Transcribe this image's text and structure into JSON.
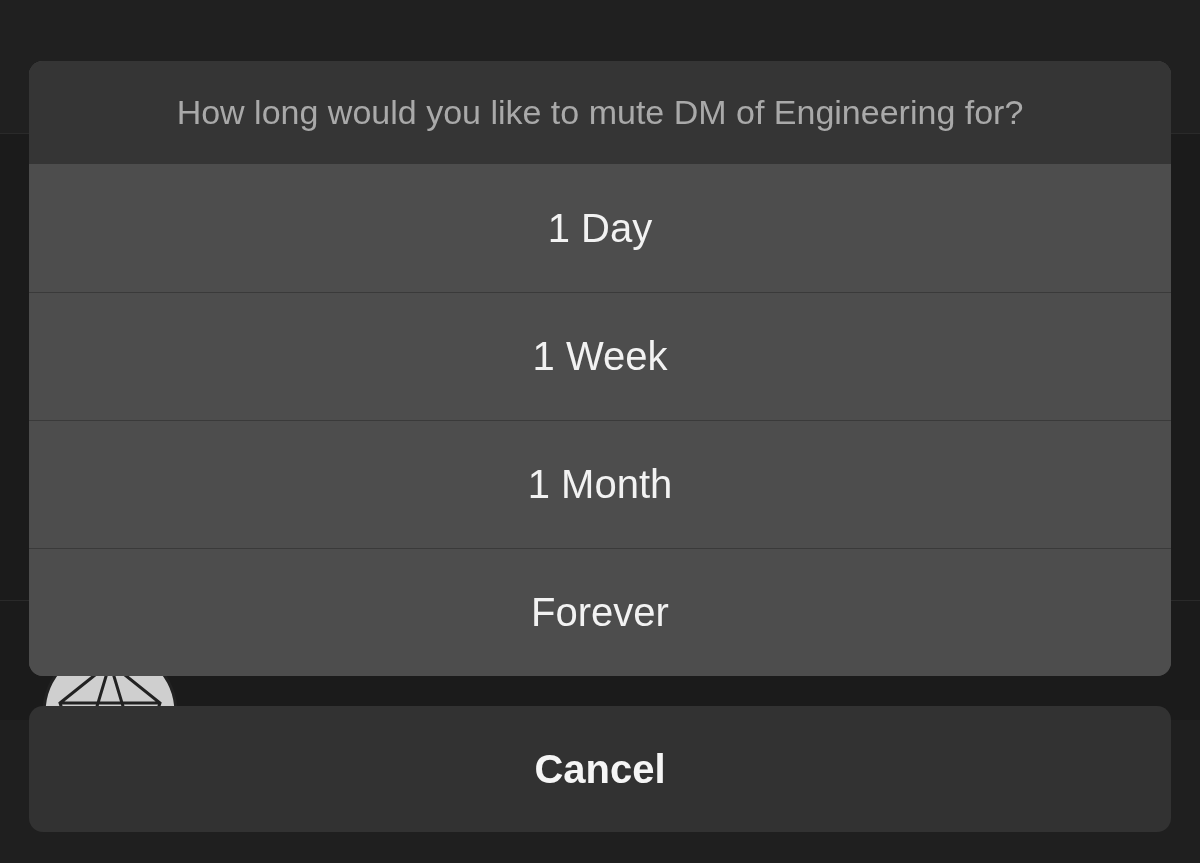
{
  "action_sheet": {
    "title": "How long would you like to mute DM of Engineering for?",
    "options": [
      {
        "label": "1 Day"
      },
      {
        "label": "1 Week"
      },
      {
        "label": "1 Month"
      },
      {
        "label": "Forever"
      }
    ],
    "cancel": "Cancel"
  }
}
